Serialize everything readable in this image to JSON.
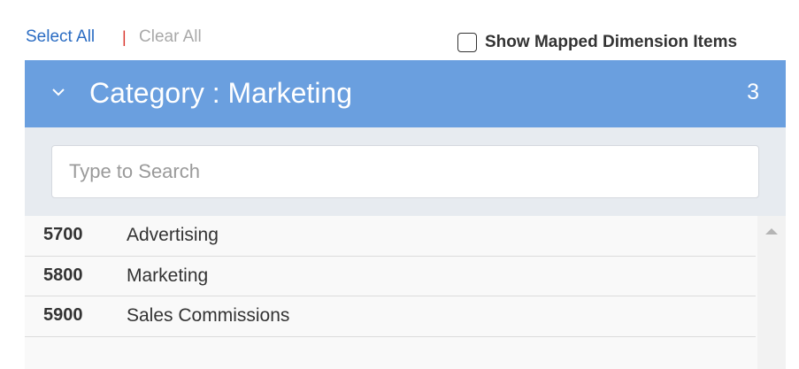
{
  "actions": {
    "select_all": "Select All",
    "separator": "|",
    "clear_all": "Clear All",
    "show_mapped_label": "Show Mapped Dimension Items",
    "show_mapped_checked": false
  },
  "category": {
    "title": "Category : Marketing",
    "count": "3",
    "expanded_icon": "chevron-down-icon"
  },
  "search": {
    "placeholder": "Type to Search",
    "value": ""
  },
  "items": [
    {
      "code": "5700",
      "name": "Advertising"
    },
    {
      "code": "5800",
      "name": "Marketing"
    },
    {
      "code": "5900",
      "name": "Sales Commissions"
    }
  ],
  "colors": {
    "header_bg": "#6a9fdf",
    "search_area_bg": "#e7ebf0",
    "link": "#2a6cc3",
    "separator": "#d9342b",
    "muted": "#a9a9a9"
  }
}
